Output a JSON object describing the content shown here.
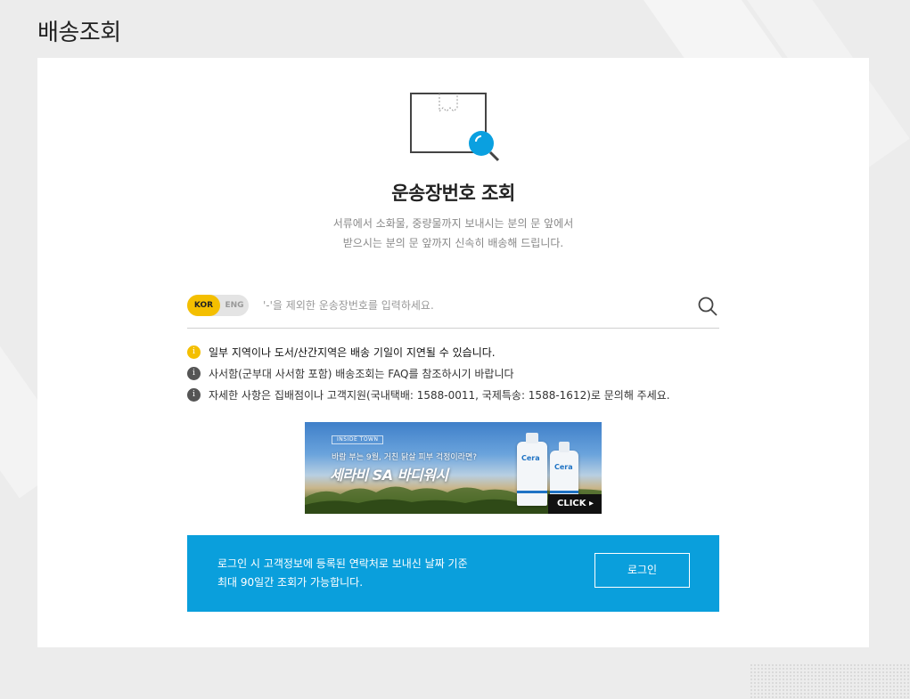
{
  "page": {
    "title": "배송조회"
  },
  "hero": {
    "title": "운송장번호 조회",
    "desc_line1": "서류에서 소화물, 중량물까지 보내시는 분의 문 앞에서",
    "desc_line2": "받으시는 분의 문 앞까지 신속히 배송해 드립니다."
  },
  "search": {
    "lang_kor": "KOR",
    "lang_eng": "ENG",
    "selected_lang": "KOR",
    "placeholder": "'-'을 제외한 운송장번호를 입력하세요.",
    "value": "",
    "search_icon": "search-icon"
  },
  "notices": [
    {
      "icon": "i",
      "text": "일부 지역이나 도서/산간지역은 배송 기일이 지연될 수 있습니다."
    },
    {
      "icon": "i",
      "text": "사서함(군부대 사서함 포함) 배송조회는 FAQ를 참조하시기 바랍니다"
    },
    {
      "icon": "i",
      "text": "자세한 사항은 집배점이나 고객지원(국내택배: 1588-0011, 국제특송: 1588-1612)로 문의해 주세요."
    }
  ],
  "ad": {
    "brand": "INSIDE TOWN",
    "subcopy": "바람 부는 9월, 거친 닭살 피부 걱정이라면?",
    "headline": "세라비 SA 바디워시",
    "bottle_logo": "Cera",
    "click_label": "CLICK ▸"
  },
  "login_box": {
    "line1": "로그인 시 고객정보에 등록된 연락처로 보내신 날짜 기준",
    "line2": "최대 90일간 조회가 가능합니다.",
    "button_label": "로그인"
  },
  "colors": {
    "accent_yellow": "#f4bf00",
    "accent_blue": "#0a9fdc",
    "background": "#ececec"
  }
}
